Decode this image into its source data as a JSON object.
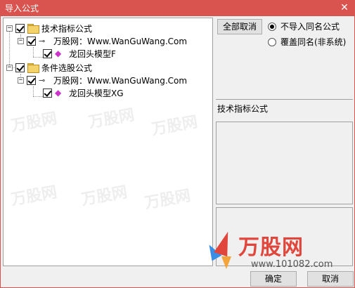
{
  "window": {
    "title": "导入公式",
    "close_label": "✕"
  },
  "tree": {
    "rows": [
      {
        "expander": "−",
        "label": "技术指标公式"
      },
      {
        "expander": "−",
        "label": "万股网：Www.WanGuWang.Com"
      },
      {
        "label": "龙回头模型F"
      },
      {
        "expander": "−",
        "label": "条件选股公式"
      },
      {
        "expander": "−",
        "label": "万股网：Www.WanGuWang.Com"
      },
      {
        "label": "龙回头模型XG"
      }
    ]
  },
  "options": {
    "cancel_all_label": "全部取消",
    "radio_skip_label": "不导入同名公式",
    "radio_overwrite_label": "覆盖同名(非系统)",
    "selected": "skip"
  },
  "info": {
    "category_label": "技术指标公式"
  },
  "footer": {
    "ok_label": "确定",
    "cancel_label": "取消"
  },
  "watermark": {
    "brand": "万股网",
    "url": "www.101082.com"
  },
  "colors": {
    "titlebar": "#d9534f",
    "logo_red": "#e0463c",
    "logo_blue": "#3a8ee6",
    "logo_yellow": "#f2a33a"
  }
}
